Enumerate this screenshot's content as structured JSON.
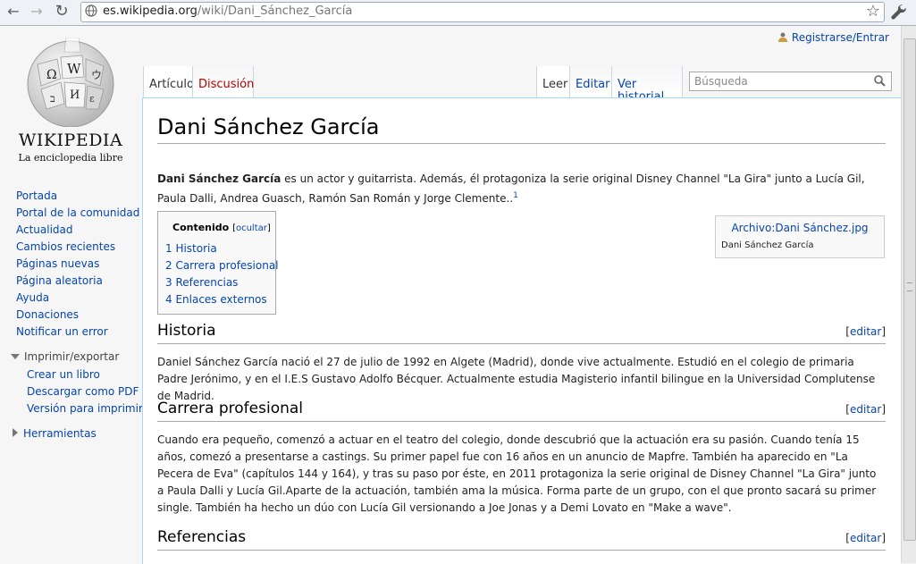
{
  "browser": {
    "url_host": "es.wikipedia.org",
    "url_path": "/wiki/Dani_Sánchez_García",
    "back_icon": "arrow-left-icon",
    "forward_icon": "arrow-right-icon",
    "reload_icon": "reload-icon",
    "star_icon": "star-icon",
    "wrench_icon": "wrench-icon"
  },
  "logo": {
    "wordmark": "WIKIPEDIA",
    "tagline": "La enciclopedia libre"
  },
  "sidebar": {
    "nav": [
      "Portada",
      "Portal de la comunidad",
      "Actualidad",
      "Cambios recientes",
      "Páginas nuevas",
      "Página aleatoria",
      "Ayuda",
      "Donaciones",
      "Notificar un error"
    ],
    "print_heading": "Imprimir/exportar",
    "print_items": [
      "Crear un libro",
      "Descargar como PDF",
      "Versión para imprimir"
    ],
    "tools_heading": "Herramientas"
  },
  "personal": {
    "login": "Registrarse/Entrar"
  },
  "tabs": {
    "article": "Artículo",
    "talk": "Discusión",
    "read": "Leer",
    "edit": "Editar",
    "history": "Ver historial"
  },
  "search": {
    "placeholder": "Búsqueda"
  },
  "article": {
    "title": "Dani Sánchez García",
    "lead_bold": "Dani Sánchez García",
    "lead_rest": " es un actor y guitarrista. Además, él protagoniza la serie original Disney Channel \"La Gira\" junto a Lucía Gil, Paula Dalli, Andrea Guasch, Ramón San Román y Jorge Clemente..",
    "lead_ref": "1",
    "toc": {
      "title": "Contenido",
      "hide": "ocultar",
      "items": [
        "1 Historia",
        "2 Carrera profesional",
        "3 Referencias",
        "4 Enlaces externos"
      ]
    },
    "thumb": {
      "link": "Archivo:Dani Sánchez.jpg",
      "caption": "Dani Sánchez García"
    },
    "edit_label": "editar",
    "sections": [
      {
        "title": "Historia",
        "text": "Daniel Sánchez García nació el 27 de julio de 1992 en Algete (Madrid), donde vive actualmente. Estudió en el colegio de primaria Padre Jerónimo, y en el I.E.S Gustavo Adolfo Bécquer. Actualmente estudia Magisterio infantil bilingue en la Universidad Complutense de Madrid."
      },
      {
        "title": "Carrera profesional",
        "text": "Cuando era pequeño, comenzó a actuar en el teatro del colegio, donde descubrió que la actuación era su pasión. Cuando tenía 15 años, comezó a presentarse a castings. Su primer papel fue con 16 años en un anuncio de Mapfre. También ha aparecido en \"La Pecera de Eva\" (capítulos 144 y 164), y tras su paso por éste, en 2011 protagoniza la serie original de Disney Channel \"La Gira\" junto a Paula Dalli y Lucía Gil.Aparte de la actuación, también ama la música. Forma parte de un grupo, con el que pronto sacará su primer single. También ha hecho un dúo con Lucía Gil versionando a Joe Jonas y a Demi Lovato en \"Make a wave\"."
      },
      {
        "title": "Referencias",
        "text": ""
      }
    ]
  },
  "colors": {
    "link": "#0645ad",
    "talk_new": "#ba0000",
    "tab_border": "#a7d7f9"
  }
}
